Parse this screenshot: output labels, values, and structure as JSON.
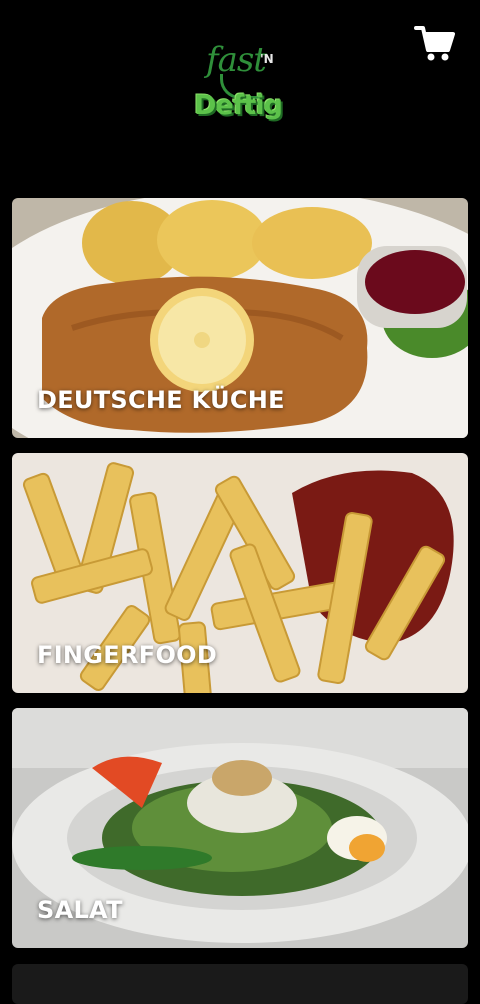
{
  "app": {
    "logo_line1": "fast",
    "logo_n": "'N",
    "logo_line2": "Deftig"
  },
  "header": {
    "cart_icon": "shopping-cart-icon"
  },
  "categories": [
    {
      "label": "DEUTSCHE KÜCHE"
    },
    {
      "label": "FINGERFOOD"
    },
    {
      "label": "SALAT"
    }
  ]
}
